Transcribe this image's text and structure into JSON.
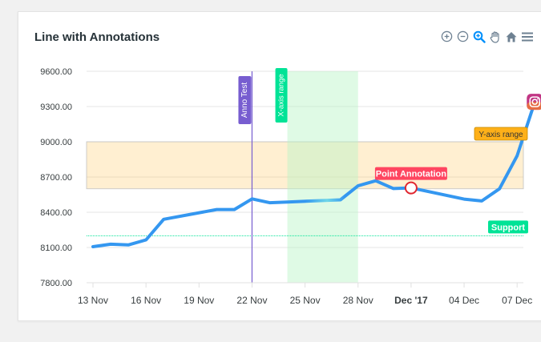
{
  "chart_title": "Line with Annotations",
  "toolbar": [
    {
      "icon": "zoom-in-icon"
    },
    {
      "icon": "zoom-out-icon"
    },
    {
      "icon": "magnifier-icon"
    },
    {
      "icon": "pan-hand-icon"
    },
    {
      "icon": "home-icon"
    },
    {
      "icon": "menu-icon"
    }
  ],
  "colors": {
    "series": "#3497f0",
    "xrange_fill": "#b9f5c6",
    "xrange_label": "#00e396",
    "yrange_fill": "#feb019",
    "yrange_label_bg": "#feb019",
    "vline": "#775dd0",
    "point_label": "#ff4560",
    "support": "#00e396"
  },
  "chart_data": {
    "type": "line",
    "title": "Line with Annotations",
    "x_tick_labels": [
      "13 Nov",
      "16 Nov",
      "19 Nov",
      "22 Nov",
      "25 Nov",
      "28 Nov",
      "Dec '17",
      "04 Dec",
      "07 Dec"
    ],
    "x": [
      "2017-11-13",
      "2017-11-14",
      "2017-11-15",
      "2017-11-16",
      "2017-11-17",
      "2017-11-20",
      "2017-11-21",
      "2017-11-22",
      "2017-11-23",
      "2017-11-24",
      "2017-11-27",
      "2017-11-28",
      "2017-11-29",
      "2017-11-30",
      "2017-12-01",
      "2017-12-04",
      "2017-12-05",
      "2017-12-06",
      "2017-12-07",
      "2017-12-08"
    ],
    "series": [
      {
        "values": [
          8107,
          8128,
          8122,
          8165,
          8340,
          8423,
          8423,
          8514,
          8481,
          8487,
          8506,
          8626,
          8668,
          8602,
          8607,
          8512,
          8496,
          8600,
          8881,
          9340
        ]
      }
    ],
    "ylim": [
      7800,
      9600
    ],
    "y_ticks": [
      "7800.00",
      "8100.00",
      "8400.00",
      "8700.00",
      "9000.00",
      "9300.00",
      "9600.00"
    ],
    "grid": true,
    "annotations": {
      "xaxis_line": {
        "x": "2017-11-22",
        "label": "Anno Test"
      },
      "xaxis_range": {
        "x": "2017-11-24",
        "x2": "2017-11-28",
        "label": "X-axis range"
      },
      "yaxis_range": {
        "y": 8600,
        "y2": 9000,
        "label": "Y-axis range"
      },
      "yaxis_line": {
        "y": 8200,
        "label": "Support"
      },
      "point": {
        "x": "2017-12-01",
        "y": 8607,
        "label": "Point Annotation"
      },
      "image_marker": {
        "x": "2017-12-08",
        "y": 9340,
        "icon": "instagram-icon"
      }
    }
  }
}
